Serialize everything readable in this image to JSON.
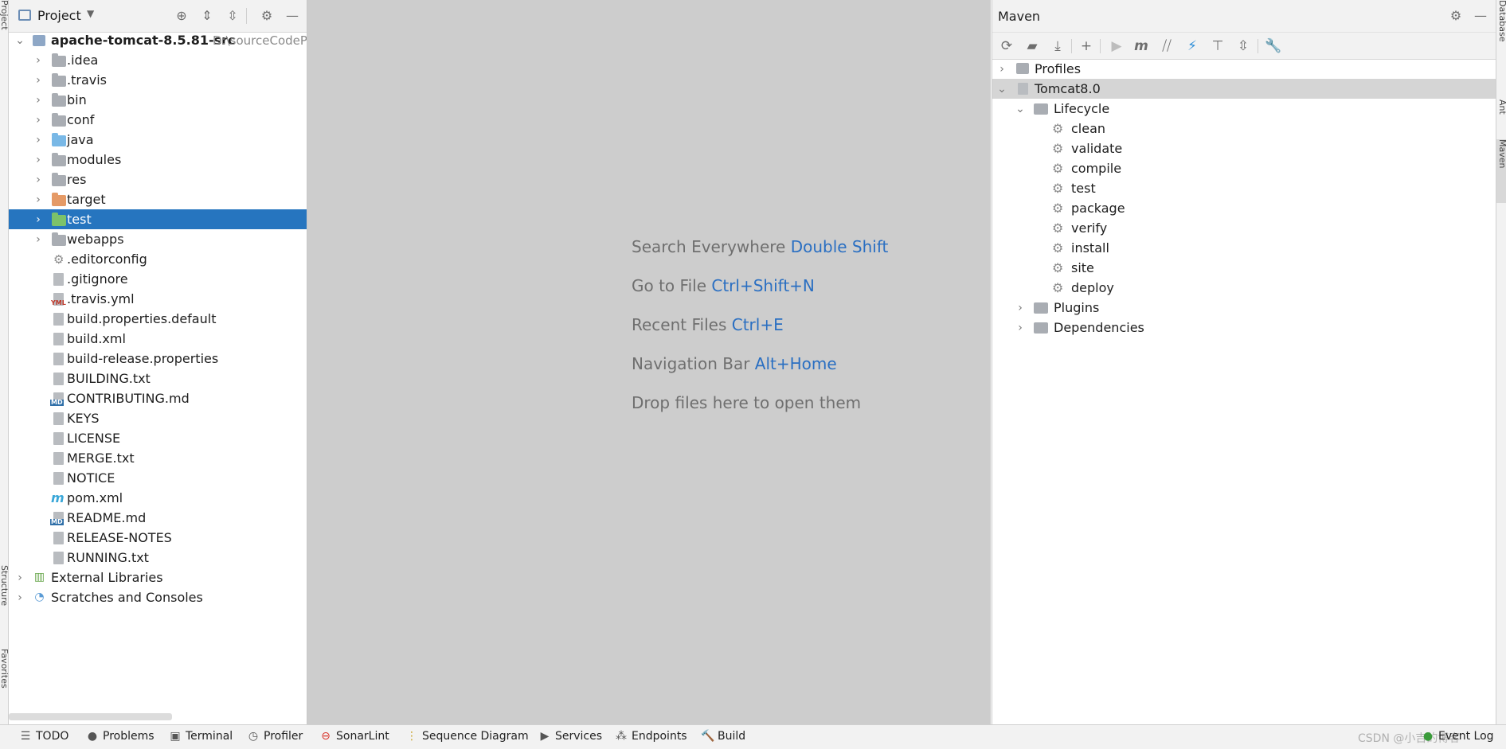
{
  "left_strip": {
    "top_tab": "Project",
    "middle_tab": "Structure",
    "bottom_tab": "Favorites"
  },
  "right_strip": {
    "tabs": [
      "Database",
      "Ant",
      "Maven"
    ]
  },
  "project_panel": {
    "title": "Project",
    "root": {
      "name": "apache-tomcat-8.5.81-src",
      "path": "D:\\sourceCodeP"
    },
    "items": [
      {
        "label": ".idea",
        "kind": "folder"
      },
      {
        "label": ".travis",
        "kind": "folder"
      },
      {
        "label": "bin",
        "kind": "folder"
      },
      {
        "label": "conf",
        "kind": "folder"
      },
      {
        "label": "java",
        "kind": "folder-source"
      },
      {
        "label": "modules",
        "kind": "folder"
      },
      {
        "label": "res",
        "kind": "folder"
      },
      {
        "label": "target",
        "kind": "folder-excluded"
      },
      {
        "label": "test",
        "kind": "folder-test",
        "selected": true
      },
      {
        "label": "webapps",
        "kind": "folder"
      },
      {
        "label": ".editorconfig",
        "kind": "settings-file"
      },
      {
        "label": ".gitignore",
        "kind": "ignore-file"
      },
      {
        "label": ".travis.yml",
        "kind": "yml-file",
        "badge": "YML"
      },
      {
        "label": "build.properties.default",
        "kind": "text-file"
      },
      {
        "label": "build.xml",
        "kind": "ant-file"
      },
      {
        "label": "build-release.properties",
        "kind": "properties-file"
      },
      {
        "label": "BUILDING.txt",
        "kind": "text-file"
      },
      {
        "label": "CONTRIBUTING.md",
        "kind": "md-file",
        "badge": "MD"
      },
      {
        "label": "KEYS",
        "kind": "text-file"
      },
      {
        "label": "LICENSE",
        "kind": "text-file"
      },
      {
        "label": "MERGE.txt",
        "kind": "text-file"
      },
      {
        "label": "NOTICE",
        "kind": "text-file"
      },
      {
        "label": "pom.xml",
        "kind": "maven-file",
        "badge": "m"
      },
      {
        "label": "README.md",
        "kind": "md-file",
        "badge": "MD"
      },
      {
        "label": "RELEASE-NOTES",
        "kind": "text-file"
      },
      {
        "label": "RUNNING.txt",
        "kind": "text-file"
      }
    ],
    "extra": [
      {
        "label": "External Libraries",
        "kind": "libraries"
      },
      {
        "label": "Scratches and Consoles",
        "kind": "scratches"
      }
    ]
  },
  "editor": {
    "hints": [
      {
        "text": "Search Everywhere",
        "key": "Double Shift"
      },
      {
        "text": "Go to File",
        "key": "Ctrl+Shift+N"
      },
      {
        "text": "Recent Files",
        "key": "Ctrl+E"
      },
      {
        "text": "Navigation Bar",
        "key": "Alt+Home"
      },
      {
        "text": "Drop files here to open them",
        "key": ""
      }
    ]
  },
  "maven_panel": {
    "title": "Maven",
    "profiles": "Profiles",
    "project": "Tomcat8.0",
    "lifecycle": "Lifecycle",
    "phases": [
      "clean",
      "validate",
      "compile",
      "test",
      "package",
      "verify",
      "install",
      "site",
      "deploy"
    ],
    "plugins": "Plugins",
    "dependencies": "Dependencies",
    "toolbar_m": "m"
  },
  "bottom_bar": {
    "tabs": [
      "TODO",
      "Problems",
      "Terminal",
      "Profiler",
      "SonarLint",
      "Sequence Diagram",
      "Services",
      "Endpoints",
      "Build"
    ],
    "right_tab": "Event Log",
    "watermark": "CSDN @小吉的博客"
  },
  "colors": {
    "selection": "#2675bf",
    "editor_bg": "#cdcdcd",
    "shortcut": "#2a6fc2"
  }
}
